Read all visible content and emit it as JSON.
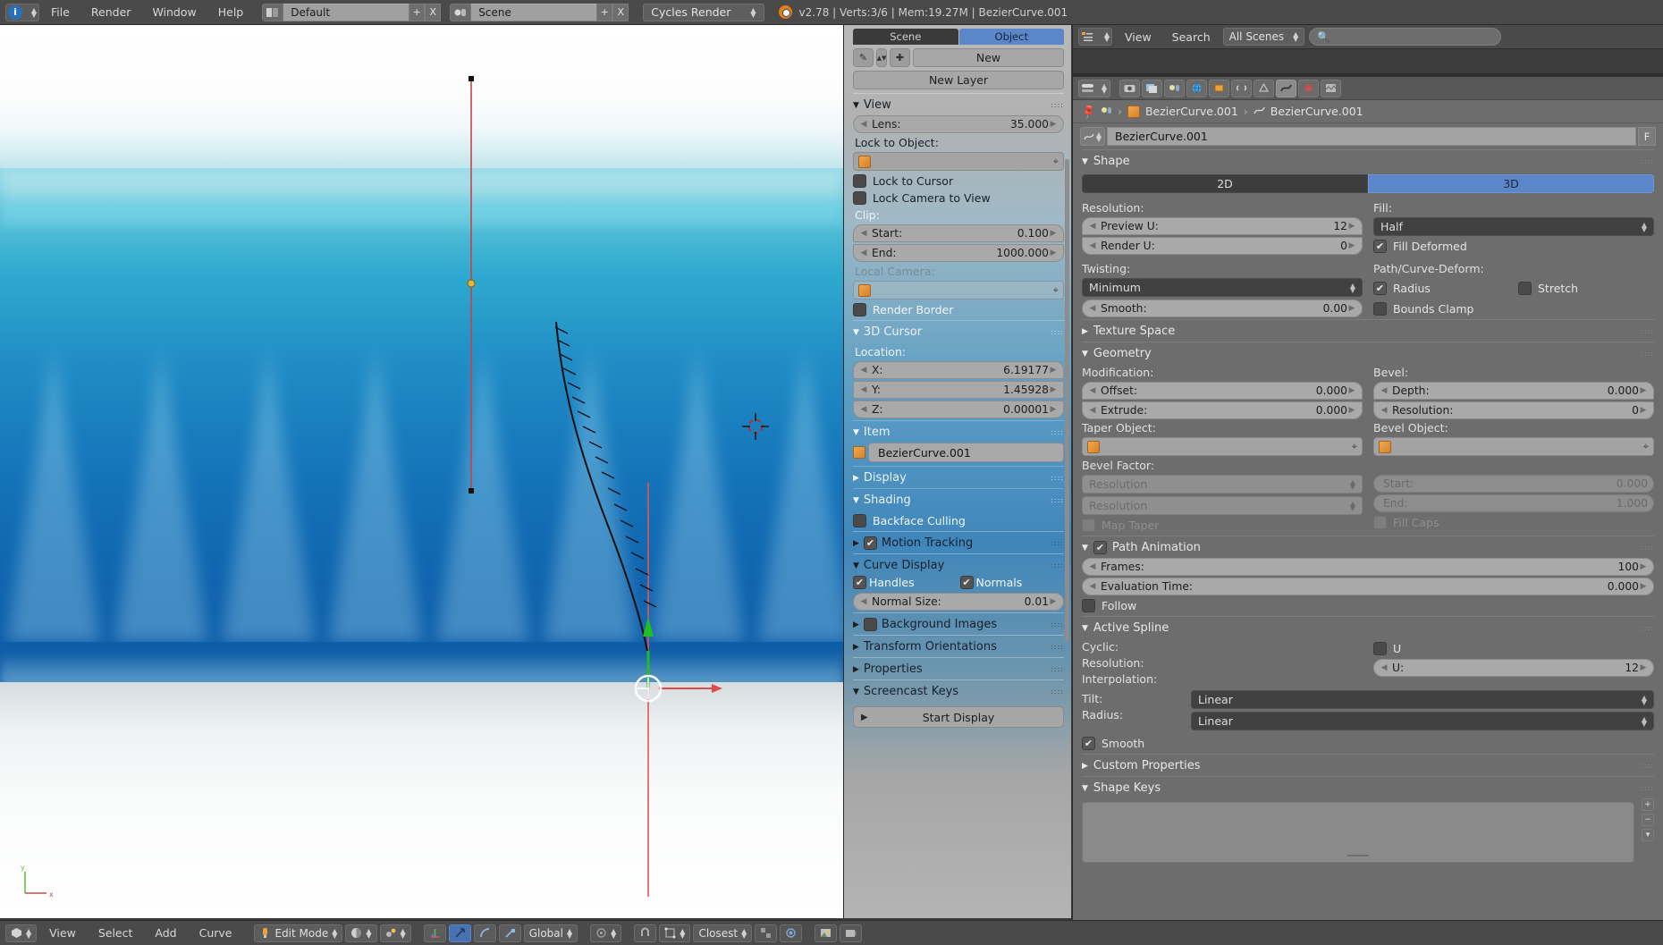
{
  "topbar": {
    "logo_icon": "blender-info-icon",
    "menus": [
      "File",
      "Render",
      "Window",
      "Help"
    ],
    "screen_layout": {
      "icon": "screen-layout-icon",
      "value": "Default",
      "add_label": "+",
      "del_label": "X"
    },
    "scene_select": {
      "icon": "scene-icon",
      "value": "Scene",
      "add_label": "+",
      "del_label": "X"
    },
    "render_engine": "Cycles Render",
    "stats": "v2.78 | Verts:3/6 | Mem:19.27M | BezierCurve.001",
    "blender_icon": "blender-logo-icon"
  },
  "viewport": {
    "axis_gizmo": {
      "y_label": "y",
      "x_label": "x"
    },
    "header": {
      "editor_type_icon": "editor-type-3dview-icon",
      "menus": [
        "View",
        "Select",
        "Add",
        "Curve"
      ],
      "mode": "Edit Mode",
      "mode_icon": "edit-mode-icon",
      "shading_icon": "shading-solid-icon",
      "pivot_icon": "pivot-point-icon",
      "manipulators": [
        "translate-manipulator-icon",
        "rotate-manipulator-icon",
        "scale-manipulator-icon"
      ],
      "orientation": "Global",
      "snap_magnet_icon": "snap-magnet-icon",
      "snap_element_icon": "snap-element-icon",
      "snap_target": "Closest",
      "proportional_icon": "proportional-edit-icon",
      "falloff_icon": "proportional-falloff-icon",
      "render_icon": "render-image-icon",
      "opengl_render_icon": "opengl-render-icon"
    }
  },
  "npanel": {
    "tabs": [
      {
        "label": "Scene",
        "active": false
      },
      {
        "label": "Object",
        "active": true
      }
    ],
    "new_button": "New",
    "new_layer_button": "New Layer",
    "brush_icon": "brush-icon",
    "add_icon": "plus-icon",
    "view": {
      "title": "View",
      "lens_label": "Lens:",
      "lens_value": "35.000",
      "lock_to_object_label": "Lock to Object:",
      "lock_object_value": "",
      "lock_to_cursor": "Lock to Cursor",
      "lock_camera_to_view": "Lock Camera to View",
      "clip_label": "Clip:",
      "clip_start_label": "Start:",
      "clip_start_value": "0.100",
      "clip_end_label": "End:",
      "clip_end_value": "1000.000",
      "local_camera_label": "Local Camera:",
      "local_camera_value": "",
      "render_border": "Render Border"
    },
    "cursor": {
      "title": "3D Cursor",
      "location_label": "Location:",
      "x_label": "X:",
      "x_value": "6.19177",
      "y_label": "Y:",
      "y_value": "1.45928",
      "z_label": "Z:",
      "z_value": "0.00001"
    },
    "item": {
      "title": "Item",
      "object_name": "BezierCurve.001"
    },
    "display": {
      "title": "Display"
    },
    "shading": {
      "title": "Shading",
      "backface_culling": "Backface Culling"
    },
    "motion_tracking": {
      "title": "Motion Tracking",
      "checked": true
    },
    "curve_display": {
      "title": "Curve Display",
      "handles": "Handles",
      "normals": "Normals",
      "normal_size_label": "Normal Size:",
      "normal_size_value": "0.01"
    },
    "background_images": {
      "title": "Background Images"
    },
    "transform_orientations": {
      "title": "Transform Orientations"
    },
    "properties": {
      "title": "Properties"
    },
    "screencast_keys": {
      "title": "Screencast Keys",
      "start_display": "Start Display"
    }
  },
  "outliner": {
    "editor_icon": "outliner-editor-icon",
    "menus": [
      "View",
      "Search"
    ],
    "scene_filter": "All Scenes",
    "search_placeholder": "",
    "search_icon": "search-icon"
  },
  "properties": {
    "tabs": [
      "render-tab-icon",
      "render-layers-tab-icon",
      "scene-tab-icon",
      "world-tab-icon",
      "object-tab-icon",
      "constraints-tab-icon",
      "modifiers-tab-icon",
      "data-tab-icon",
      "material-tab-icon",
      "texture-tab-icon"
    ],
    "editor_icon": "properties-editor-icon",
    "breadcrumb": [
      "BezierCurve.001",
      "BezierCurve.001"
    ],
    "pin_icon": "pin-icon",
    "id_block": {
      "icon": "curve-data-icon",
      "name": "BezierCurve.001",
      "fake_user": "F"
    },
    "shape": {
      "title": "Shape",
      "dimension_2d": "2D",
      "dimension_3d": "3D",
      "active_dimension": "3D",
      "resolution_label": "Resolution:",
      "preview_u_label": "Preview U:",
      "preview_u_value": "12",
      "render_u_label": "Render U:",
      "render_u_value": "0",
      "fill_label": "Fill:",
      "fill_mode": "Half",
      "fill_deformed": "Fill Deformed",
      "twisting_label": "Twisting:",
      "twist_method": "Minimum",
      "smooth_label": "Smooth:",
      "smooth_value": "0.00",
      "path_curve_deform_label": "Path/Curve-Deform:",
      "radius": "Radius",
      "stretch": "Stretch",
      "bounds_clamp": "Bounds Clamp"
    },
    "texture_space": {
      "title": "Texture Space"
    },
    "geometry": {
      "title": "Geometry",
      "modification_label": "Modification:",
      "offset_label": "Offset:",
      "offset_value": "0.000",
      "extrude_label": "Extrude:",
      "extrude_value": "0.000",
      "bevel_label": "Bevel:",
      "depth_label": "Depth:",
      "depth_value": "0.000",
      "bevel_resolution_label": "Resolution:",
      "bevel_resolution_value": "0",
      "taper_object_label": "Taper Object:",
      "taper_object_value": "",
      "bevel_object_label": "Bevel Object:",
      "bevel_object_value": "",
      "bevel_factor_label": "Bevel Factor:",
      "bf_start_mode": "Resolution",
      "bf_start_label": "Start:",
      "bf_start_value": "0.000",
      "bf_end_mode": "Resolution",
      "bf_end_label": "End:",
      "bf_end_value": "1.000",
      "map_taper": "Map Taper",
      "fill_caps": "Fill Caps"
    },
    "path_animation": {
      "title": "Path Animation",
      "enabled": true,
      "frames_label": "Frames:",
      "frames_value": "100",
      "evaluation_time_label": "Evaluation Time:",
      "evaluation_time_value": "0.000",
      "follow": "Follow"
    },
    "active_spline": {
      "title": "Active Spline",
      "cyclic_label": "Cyclic:",
      "cyclic_u": "U",
      "resolution_label": "Resolution:",
      "resolution_u_label": "U:",
      "resolution_u_value": "12",
      "interpolation_label": "Interpolation:",
      "tilt_label": "Tilt:",
      "tilt_value": "Linear",
      "radius_label": "Radius:",
      "radius_value": "Linear",
      "smooth": "Smooth"
    },
    "custom_properties": {
      "title": "Custom Properties"
    },
    "shape_keys": {
      "title": "Shape Keys"
    }
  },
  "colors": {
    "accent_blue": "#5b87c9",
    "orange": "#e87d0d",
    "panel_bg": "#6d6d6d",
    "header_bg": "#4a4a4a",
    "curve_black": "#101010",
    "handle_red": "#c24545",
    "axis_green": "#22c022",
    "axis_red": "#e85050"
  }
}
